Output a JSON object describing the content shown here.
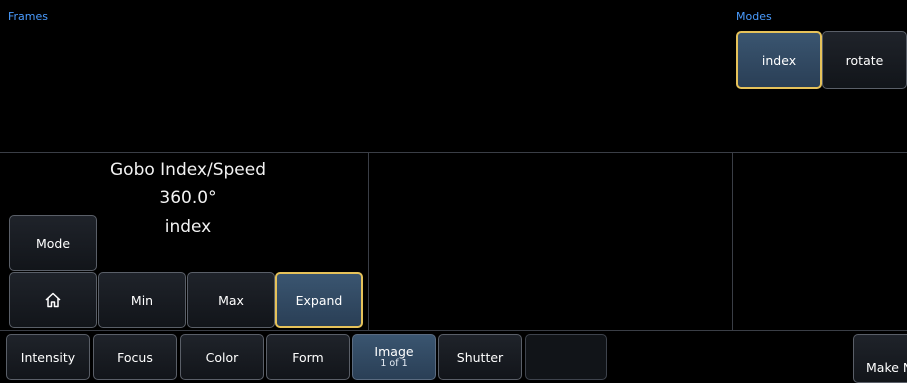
{
  "frames_label": "Frames",
  "modes": {
    "label": "Modes",
    "buttons": [
      {
        "label": "index",
        "selected": true
      },
      {
        "label": "rotate",
        "selected": false
      }
    ]
  },
  "encoder": {
    "title": "Gobo Index/Speed",
    "value": "360.0°",
    "mode_value": "index",
    "mode_button": "Mode",
    "home_icon": "home-icon",
    "min": "Min",
    "max": "Max",
    "expand": "Expand"
  },
  "categories": {
    "intensity": "Intensity",
    "focus": "Focus",
    "color": "Color",
    "form": "Form",
    "image": "Image",
    "image_page": "1 of 1",
    "shutter": "Shutter",
    "make": "Make N"
  },
  "colors": {
    "accent_blue": "#4a9cff",
    "selected_border": "#e6c25a",
    "active_tab": "#3a5570"
  }
}
